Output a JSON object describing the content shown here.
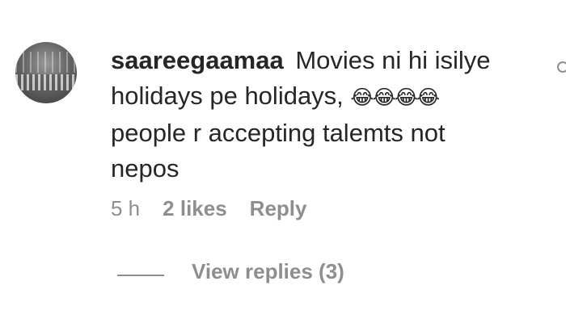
{
  "comment": {
    "username": "saareegaamaa",
    "text": "Movies ni hi isilye holidays pe holidays,",
    "emoji": "😂😂😂😂",
    "text_continued": "people r accepting talemts not nepos"
  },
  "meta": {
    "time": "5 h",
    "likes": "2 likes",
    "reply": "Reply"
  },
  "replies": {
    "label": "View replies (3)"
  },
  "colors": {
    "text": "#262626",
    "secondary": "#8e8e8e"
  }
}
